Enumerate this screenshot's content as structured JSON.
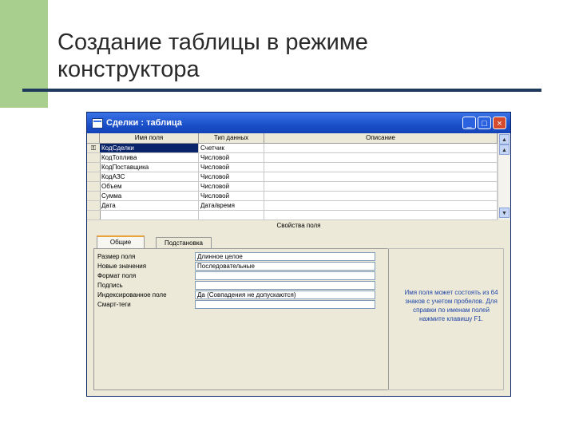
{
  "slide": {
    "title": "Создание таблицы в режиме\nконструктора"
  },
  "window": {
    "title": "Сделки : таблица",
    "buttons": {
      "minimize": "_",
      "maximize": "□",
      "close": "×"
    }
  },
  "grid": {
    "columns": [
      "Имя поля",
      "Тип данных",
      "Описание"
    ],
    "rows": [
      {
        "name": "КодСделки",
        "type": "Счетчик",
        "desc": "",
        "key": true
      },
      {
        "name": "КодТоплива",
        "type": "Числовой",
        "desc": ""
      },
      {
        "name": "КодПоставщика",
        "type": "Числовой",
        "desc": ""
      },
      {
        "name": "КодАЗС",
        "type": "Числовой",
        "desc": ""
      },
      {
        "name": "Объем",
        "type": "Числовой",
        "desc": ""
      },
      {
        "name": "Сумма",
        "type": "Числовой",
        "desc": ""
      },
      {
        "name": "Дата",
        "type": "Дата/время",
        "desc": ""
      }
    ],
    "key_glyph": "⚿"
  },
  "properties": {
    "label": "Свойства поля",
    "tabs": [
      "Общие",
      "Подстановка"
    ],
    "rows": [
      {
        "label": "Размер поля",
        "value": "Длинное целое"
      },
      {
        "label": "Новые значения",
        "value": "Последовательные"
      },
      {
        "label": "Формат поля",
        "value": ""
      },
      {
        "label": "Подпись",
        "value": ""
      },
      {
        "label": "Индексированное поле",
        "value": "Да (Совпадения не допускаются)"
      },
      {
        "label": "Смарт-теги",
        "value": ""
      }
    ],
    "hint": "Имя поля может состоять из 64 знаков с учетом пробелов. Для справки по именам полей нажмите клавишу F1."
  },
  "colors": {
    "titlebar": "#2b62e0",
    "selection": "#0a246a",
    "hint": "#2046a8"
  }
}
